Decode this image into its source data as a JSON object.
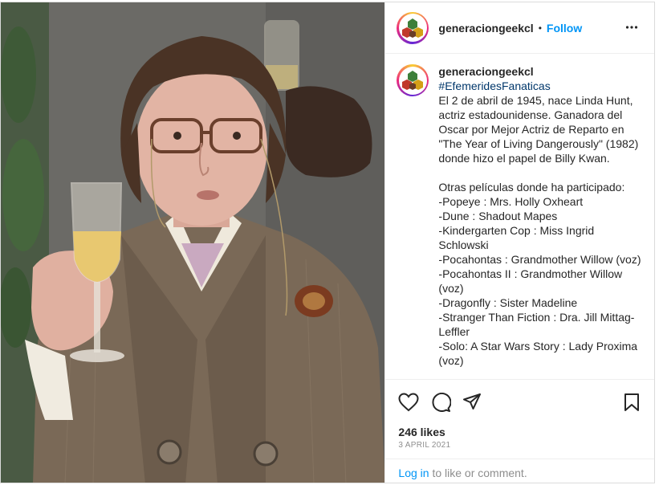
{
  "post": {
    "username": "generaciongeekcl",
    "separator": "•",
    "follow_label": "Follow",
    "more_icon": "more-horizontal-icon"
  },
  "caption": {
    "username": "generaciongeekcl",
    "hashtag": "#EfemeridesFanaticas",
    "text": "El 2 de abril de 1945, nace Linda Hunt, actriz estadounidense. Ganadora del Oscar por Mejor Actriz de Reparto en \"The Year of Living Dangerously\" (1982) donde hizo el papel de Billy Kwan.\n\nOtras películas donde ha participado:\n-Popeye : Mrs. Holly Oxheart\n-Dune : Shadout Mapes\n-Kindergarten Cop : Miss Ingrid Schlowski\n-Pocahontas : Grandmother Willow (voz)\n-Pocahontas II : Grandmother Willow (voz)\n-Dragonfly : Sister Madeline\n-Stranger Than Fiction : Dra. Jill Mittag-Leffler\n-Solo: A Star Wars Story : Lady Proxima (voz)"
  },
  "actions": {
    "like_icon": "heart-icon",
    "comment_icon": "comment-icon",
    "share_icon": "send-icon",
    "save_icon": "bookmark-icon"
  },
  "stats": {
    "likes": "246 likes",
    "date": "3 APRIL 2021"
  },
  "comment_bar": {
    "login_label": "Log in",
    "rest_text": " to like or comment."
  },
  "colors": {
    "accent": "#0095f6",
    "text": "#262626",
    "muted": "#8e8e8e",
    "hashtag": "#00376b"
  }
}
